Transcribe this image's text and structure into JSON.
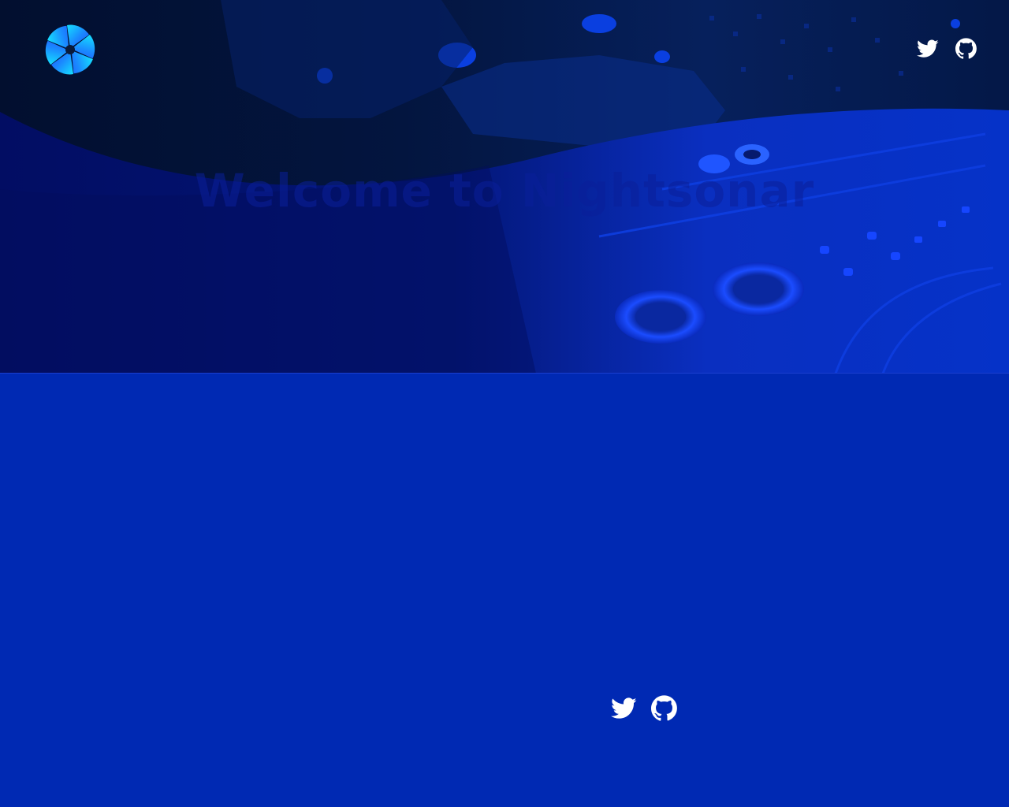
{
  "app": {
    "logo_icon": "pinwheel-logo-icon"
  },
  "colors": {
    "background": "#0029b3",
    "hero_dark": "#020f2f",
    "hero_blue": "#02106a",
    "icon": "#ffffff"
  },
  "header": {
    "social": [
      {
        "icon": "twitter-icon"
      },
      {
        "icon": "github-icon"
      }
    ]
  },
  "hero": {
    "heading": "Welcome to Nightsonar",
    "subtitle": ""
  },
  "footer": {
    "social": [
      {
        "icon": "twitter-icon"
      },
      {
        "icon": "github-icon"
      }
    ]
  }
}
